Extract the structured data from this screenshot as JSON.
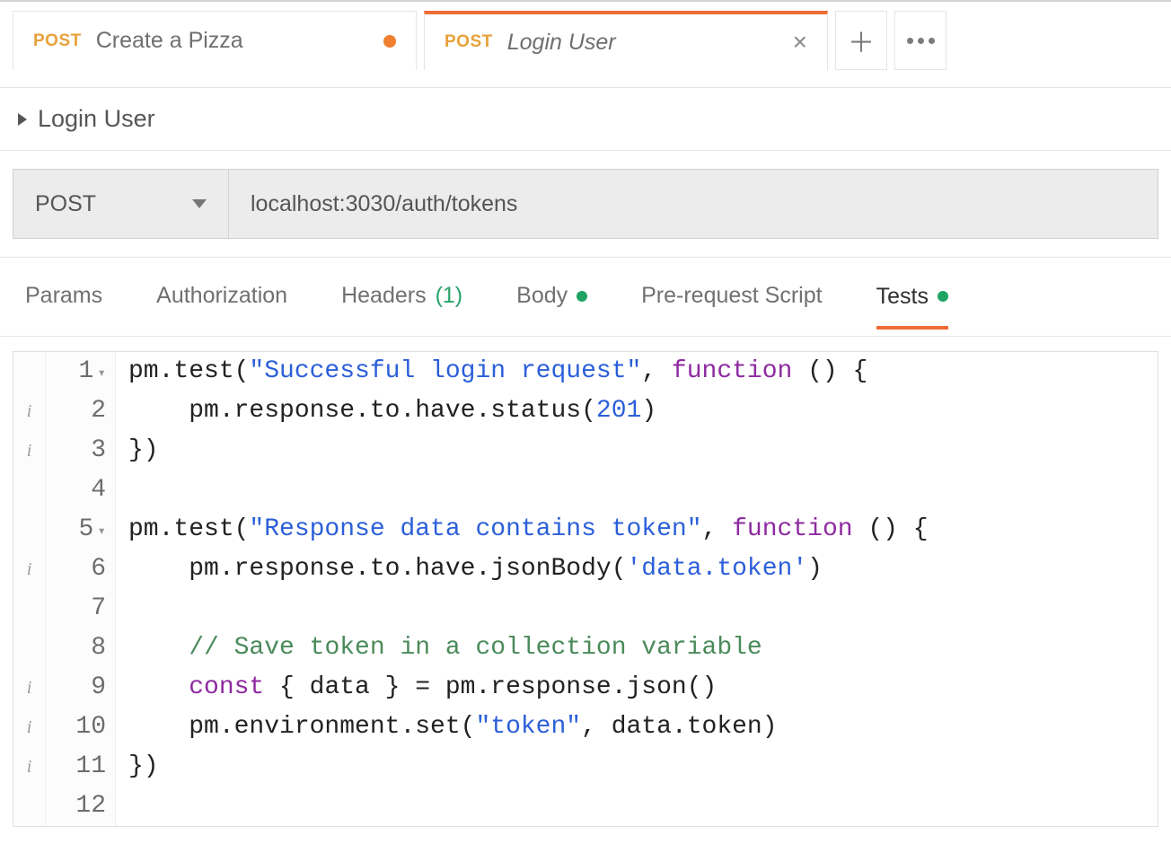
{
  "tabs": [
    {
      "method": "POST",
      "title": "Create a Pizza",
      "italic": false,
      "unsaved": true
    },
    {
      "method": "POST",
      "title": "Login User",
      "italic": true,
      "unsaved": false,
      "active": true
    }
  ],
  "request": {
    "title": "Login User",
    "method": "POST",
    "url": "localhost:3030/auth/tokens"
  },
  "subtabs": {
    "params": "Params",
    "authorization": "Authorization",
    "headers": "Headers",
    "headers_count": "(1)",
    "body": "Body",
    "prerequest": "Pre-request Script",
    "tests": "Tests"
  },
  "code": {
    "lines": [
      {
        "n": 1,
        "info": "",
        "fold": true,
        "html": "pm.test(<span class='tok-str'>\"Successful login request\"</span>, <span class='tok-kw'>function</span> () {"
      },
      {
        "n": 2,
        "info": "i",
        "fold": false,
        "html": "    pm.response.to.have.status(<span class='tok-num'>201</span>)"
      },
      {
        "n": 3,
        "info": "i",
        "fold": false,
        "html": "})"
      },
      {
        "n": 4,
        "info": "",
        "fold": false,
        "html": ""
      },
      {
        "n": 5,
        "info": "",
        "fold": true,
        "html": "pm.test(<span class='tok-str'>\"Response data contains token\"</span>, <span class='tok-kw'>function</span> () {"
      },
      {
        "n": 6,
        "info": "i",
        "fold": false,
        "html": "    pm.response.to.have.jsonBody(<span class='tok-str'>'data.token'</span>)"
      },
      {
        "n": 7,
        "info": "",
        "fold": false,
        "html": ""
      },
      {
        "n": 8,
        "info": "",
        "fold": false,
        "html": "    <span class='tok-comment'>// Save token in a collection variable</span>"
      },
      {
        "n": 9,
        "info": "i",
        "fold": false,
        "html": "    <span class='tok-kw'>const</span> { data } = pm.response.json()"
      },
      {
        "n": 10,
        "info": "i",
        "fold": false,
        "html": "    pm.environment.set(<span class='tok-str'>\"token\"</span>, data.token)"
      },
      {
        "n": 11,
        "info": "i",
        "fold": false,
        "html": "})"
      },
      {
        "n": 12,
        "info": "",
        "fold": false,
        "html": ""
      }
    ]
  }
}
